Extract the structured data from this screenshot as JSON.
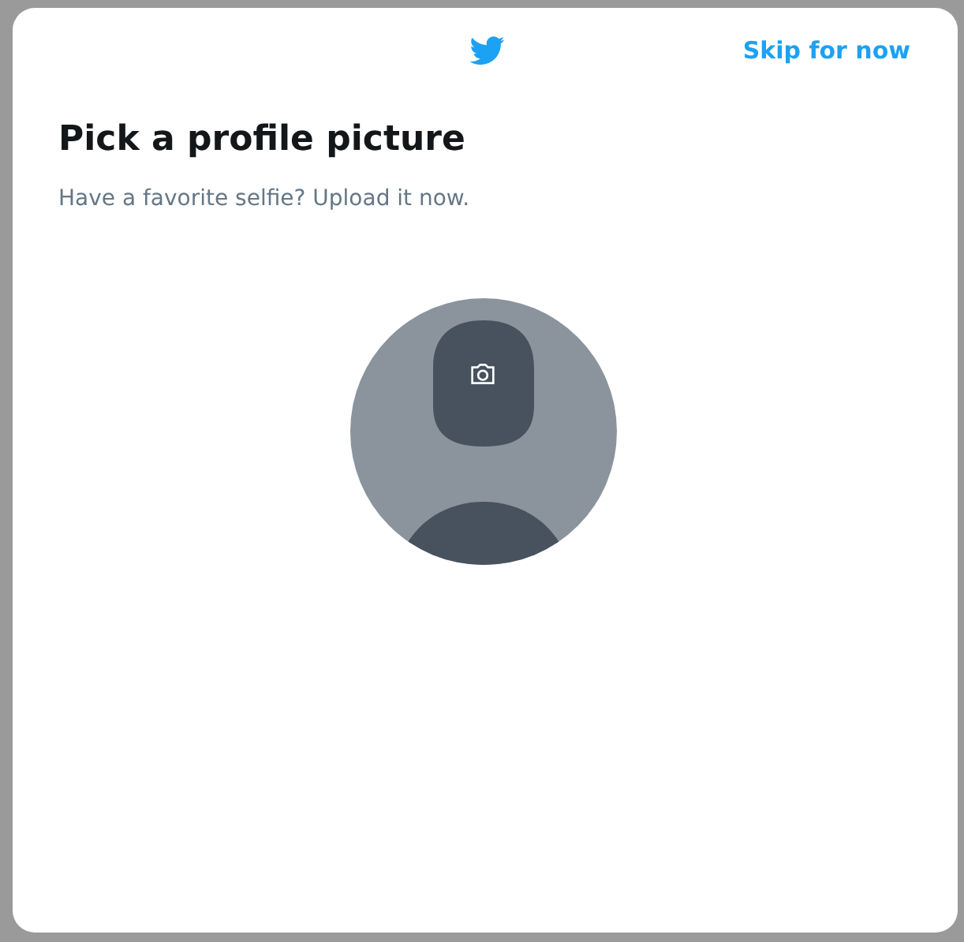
{
  "header": {
    "skip_link": "Skip for now"
  },
  "title": "Pick a profile picture",
  "subtitle": "Have a favorite selfie? Upload it now."
}
